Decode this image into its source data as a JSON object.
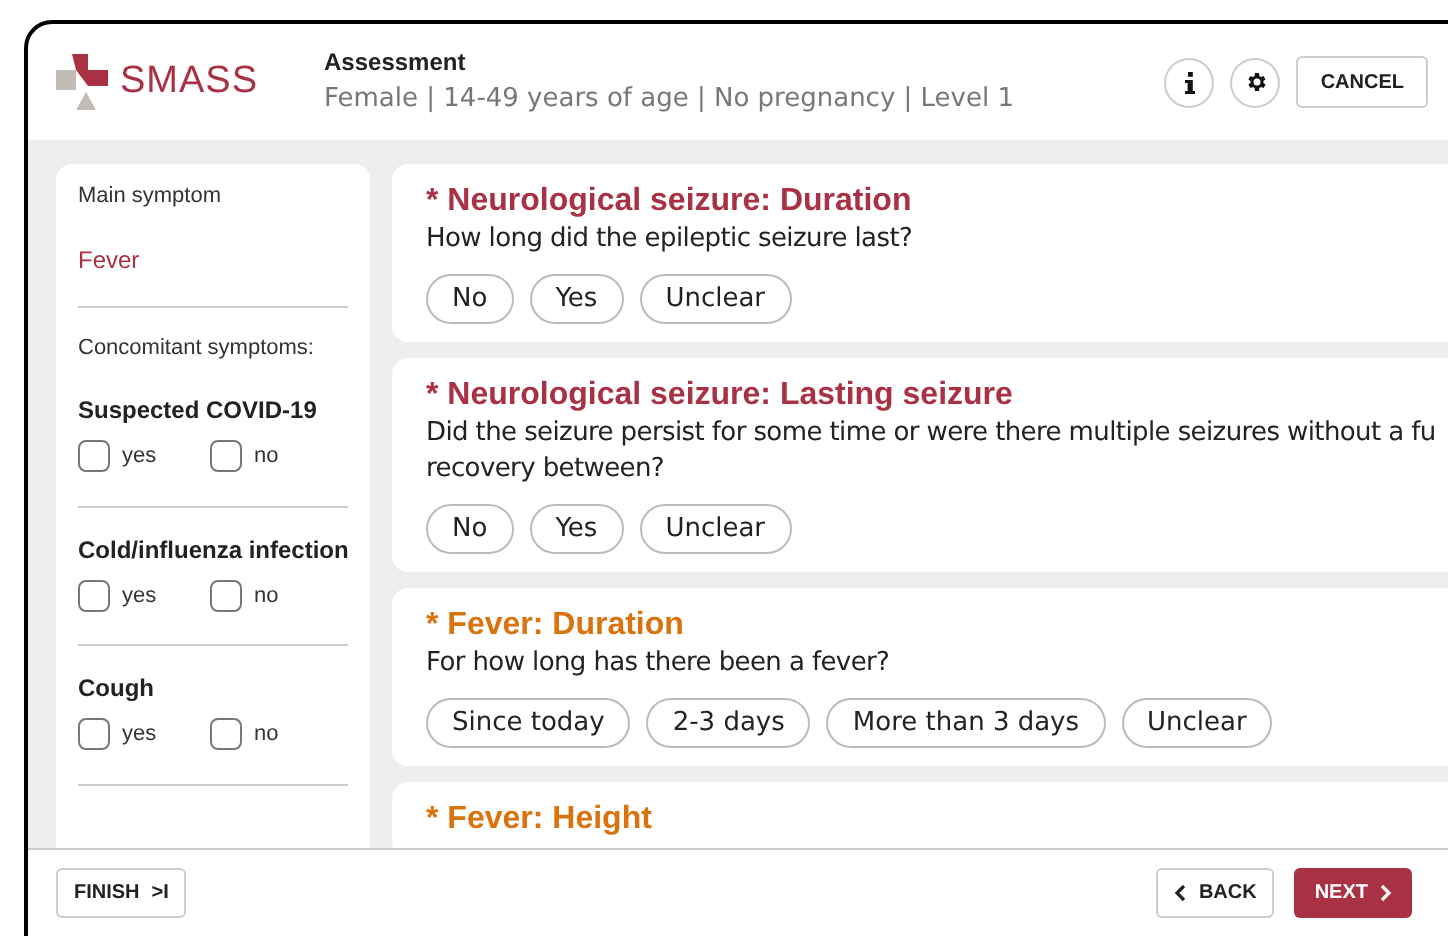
{
  "header": {
    "logo_text": "SMASS",
    "title": "Assessment",
    "subtitle": "Female | 14-49 years of age | No pregnancy | Level 1",
    "cancel": "CANCEL"
  },
  "sidebar": {
    "main_label": "Main symptom",
    "main_value": "Fever",
    "concomitant_label": "Concomitant symptoms:",
    "symptoms": [
      {
        "name": "Suspected COVID-19",
        "options": [
          {
            "label": "yes",
            "checked": false
          },
          {
            "label": "no",
            "checked": false
          }
        ]
      },
      {
        "name": "Cold/influenza infection",
        "options": [
          {
            "label": "yes",
            "checked": false
          },
          {
            "label": "no",
            "checked": false
          }
        ]
      },
      {
        "name": "Cough",
        "options": [
          {
            "label": "yes",
            "checked": false
          },
          {
            "label": "no",
            "checked": false
          }
        ]
      }
    ]
  },
  "questions": [
    {
      "title": "* Neurological seizure: Duration",
      "color": "#a83244",
      "text": [
        "How long did the epileptic seizure last?"
      ],
      "answers": [
        "No",
        "Yes",
        "Unclear"
      ]
    },
    {
      "title": "* Neurological seizure: Lasting seizure",
      "color": "#a83244",
      "text": [
        "Did the seizure persist for some time or were there multiple seizures without a fu",
        "recovery between?"
      ],
      "answers": [
        "No",
        "Yes",
        "Unclear"
      ]
    },
    {
      "title": "* Fever: Duration",
      "color": "#d9730d",
      "text": [
        "For how long has there been a fever?"
      ],
      "answers": [
        "Since today",
        "2-3 days",
        "More than 3 days",
        "Unclear"
      ]
    },
    {
      "title": "* Fever: Height",
      "color": "#d9730d"
    }
  ],
  "footer": {
    "finish": "FINISH",
    "finish_icon": ">I",
    "back": "BACK",
    "next": "NEXT"
  }
}
